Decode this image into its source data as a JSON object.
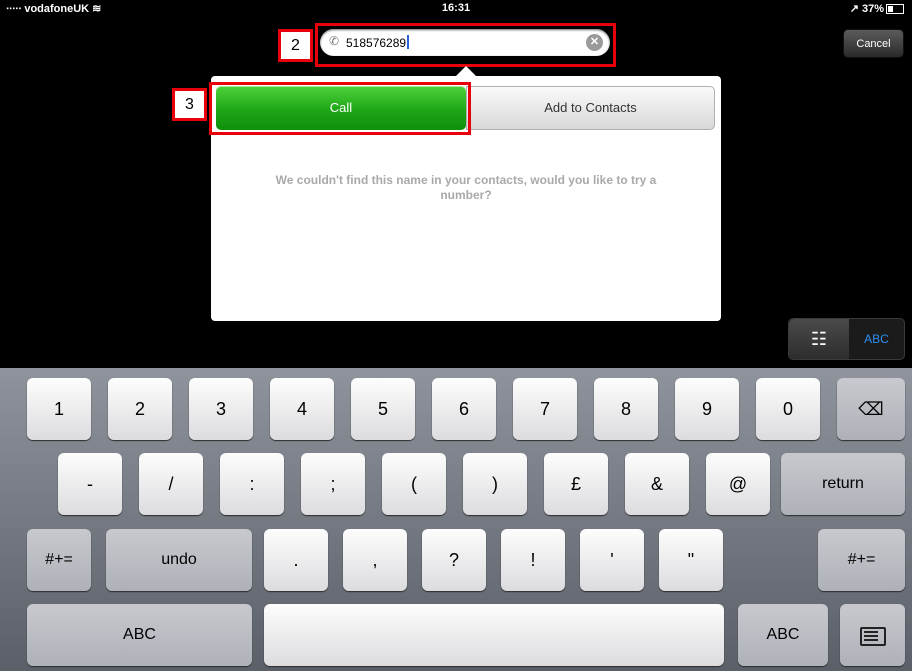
{
  "status": {
    "carrier": "∙∙∙∙∙ vodafoneUK ≋",
    "time": "16:31",
    "battery": "↗ 37%"
  },
  "search": {
    "value": "518576289",
    "phone_icon": "✆",
    "clear_icon": "✕"
  },
  "cancel_label": "Cancel",
  "annotations": {
    "field_number": "2",
    "call_number": "3"
  },
  "popover": {
    "call_label": "Call",
    "add_contacts_label": "Add to Contacts",
    "message": "We couldn't find this name in your contacts, would you like to try a number?"
  },
  "mode_toggle": {
    "keypad_icon": "☷",
    "abc_label": "ABC"
  },
  "keyboard": {
    "row1": [
      "1",
      "2",
      "3",
      "4",
      "5",
      "6",
      "7",
      "8",
      "9",
      "0"
    ],
    "backspace_icon": "⌫",
    "row2": [
      "-",
      "/",
      ":",
      ";",
      "(",
      ")",
      "£",
      "&",
      "@"
    ],
    "return_label": "return",
    "row3_left": "#+=",
    "undo_label": "undo",
    "row3": [
      ".",
      ",",
      "?",
      "!",
      "'",
      "\""
    ],
    "row3_right": "#+=",
    "abc_left": "ABC",
    "abc_right": "ABC",
    "hide_icon": "keyboard-hide"
  },
  "colors": {
    "call_green": "#1ea617",
    "annotation_red": "#e8000b",
    "abc_blue": "#2f8ff0"
  }
}
